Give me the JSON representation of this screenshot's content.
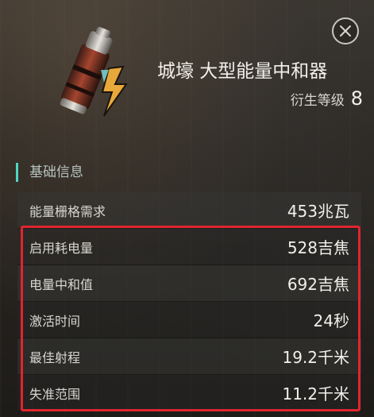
{
  "item": {
    "icon": "energy-battery-icon",
    "title": "城壕 大型能量中和器",
    "tier_label": "衍生等级",
    "tier_value": "8"
  },
  "section": {
    "title": "基础信息"
  },
  "stats": [
    {
      "label": "能量栅格需求",
      "value": "453兆瓦"
    },
    {
      "label": "启用耗电量",
      "value": "528吉焦"
    },
    {
      "label": "电量中和值",
      "value": "692吉焦"
    },
    {
      "label": "激活时间",
      "value": "24秒"
    },
    {
      "label": "最佳射程",
      "value": "19.2千米"
    },
    {
      "label": "失准范围",
      "value": "11.2千米"
    }
  ],
  "colors": {
    "accent": "#4fd6c4",
    "highlight": "#e0252f"
  }
}
